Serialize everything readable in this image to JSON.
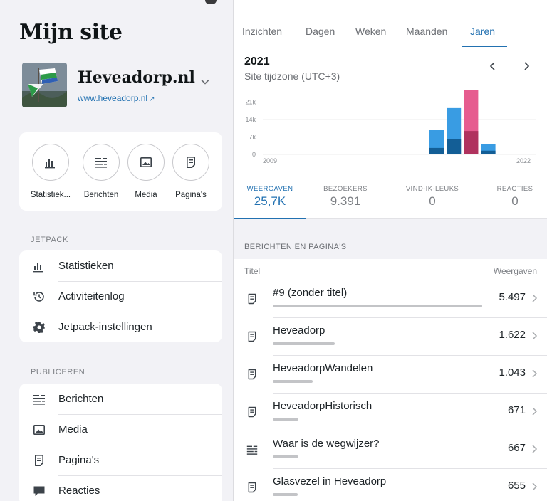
{
  "sidebar": {
    "title": "Mijn site",
    "site_name": "Heveadorp.nl",
    "site_url": "www.heveadorp.nl",
    "quick_actions": [
      {
        "label": "Statistiek...",
        "icon": "stats-icon"
      },
      {
        "label": "Berichten",
        "icon": "posts-icon"
      },
      {
        "label": "Media",
        "icon": "media-icon"
      },
      {
        "label": "Pagina's",
        "icon": "page-icon"
      }
    ],
    "jetpack_label": "JETPACK",
    "jetpack_items": [
      {
        "label": "Statistieken",
        "icon": "stats-icon"
      },
      {
        "label": "Activiteitenlog",
        "icon": "history-icon"
      },
      {
        "label": "Jetpack-instellingen",
        "icon": "gear-icon"
      }
    ],
    "publish_label": "PUBLICEREN",
    "publish_items": [
      {
        "label": "Berichten",
        "icon": "posts-icon"
      },
      {
        "label": "Media",
        "icon": "media-icon"
      },
      {
        "label": "Pagina's",
        "icon": "page-icon"
      },
      {
        "label": "Reacties",
        "icon": "comment-icon"
      }
    ]
  },
  "tabs": [
    {
      "label": "Inzichten",
      "active": false
    },
    {
      "label": "Dagen",
      "active": false
    },
    {
      "label": "Weken",
      "active": false
    },
    {
      "label": "Maanden",
      "active": false
    },
    {
      "label": "Jaren",
      "active": true
    }
  ],
  "period": {
    "year": "2021",
    "timezone": "Site tijdzone (UTC+3)"
  },
  "colors": {
    "accent": "#2271b1",
    "bar_light": "#399ce3",
    "bar_dark": "#135e96",
    "bar_selected_light": "#e65c8f",
    "bar_selected_dark": "#b0325e"
  },
  "chart_data": {
    "type": "bar",
    "x": [
      "2009",
      "2010",
      "2011",
      "2012",
      "2013",
      "2014",
      "2015",
      "2016",
      "2017",
      "2018",
      "2019",
      "2020",
      "2021",
      "2022"
    ],
    "x_tick_labels": [
      "2009",
      "2022"
    ],
    "yticks": [
      "21k",
      "14k",
      "7k",
      "0"
    ],
    "ylim": [
      0,
      25700
    ],
    "selected": "2021",
    "series": [
      {
        "values": [
          0,
          0,
          0,
          0,
          0,
          0,
          0,
          0,
          0,
          0,
          9800,
          18600,
          25700,
          4200
        ]
      },
      {
        "values": [
          0,
          0,
          0,
          0,
          0,
          0,
          0,
          0,
          0,
          0,
          2600,
          6000,
          9391,
          1500
        ]
      }
    ]
  },
  "metrics": [
    {
      "label": "WEERGAVEN",
      "value": "25,7K",
      "active": true
    },
    {
      "label": "BEZOEKERS",
      "value": "9.391",
      "active": false
    },
    {
      "label": "VIND-IK-LEUKS",
      "value": "0",
      "active": false
    },
    {
      "label": "REACTIES",
      "value": "0",
      "active": false
    }
  ],
  "posts": {
    "section_title": "BERICHTEN EN PAGINA'S",
    "col_title": "Titel",
    "col_views": "Weergaven",
    "max_views": 5497,
    "rows": [
      {
        "title": "#9 (zonder titel)",
        "value": "5.497",
        "views": 5497,
        "icon": "page-icon"
      },
      {
        "title": "Heveadorp",
        "value": "1.622",
        "views": 1622,
        "icon": "page-icon"
      },
      {
        "title": "HeveadorpWandelen",
        "value": "1.043",
        "views": 1043,
        "icon": "page-icon"
      },
      {
        "title": "HeveadorpHistorisch",
        "value": "671",
        "views": 671,
        "icon": "page-icon"
      },
      {
        "title": "Waar is de wegwijzer?",
        "value": "667",
        "views": 667,
        "icon": "posts-icon"
      },
      {
        "title": "Glasvezel in Heveadorp",
        "value": "655",
        "views": 655,
        "icon": "page-icon"
      }
    ]
  }
}
